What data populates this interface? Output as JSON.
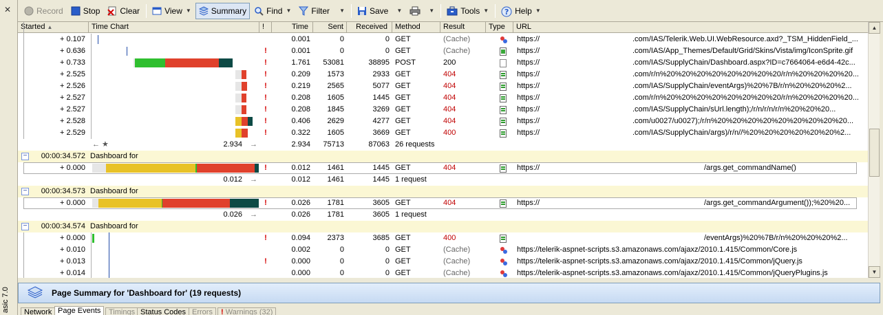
{
  "app": {
    "side_label": "asic 7.0"
  },
  "toolbar": {
    "record": "Record",
    "stop": "Stop",
    "clear": "Clear",
    "view": "View",
    "summary": "Summary",
    "find": "Find",
    "filter": "Filter",
    "save": "Save",
    "tools": "Tools",
    "help": "Help"
  },
  "columns": {
    "started": "Started",
    "time_chart": "Time Chart",
    "bang": "!",
    "time": "Time",
    "sent": "Sent",
    "received": "Received",
    "method": "Method",
    "result": "Result",
    "type": "Type",
    "url": "URL"
  },
  "group1": {
    "rows": [
      {
        "started": "+ 0.107",
        "bang": "",
        "time": "0.001",
        "sent": "0",
        "received": "0",
        "method": "GET",
        "result": "(Cache)",
        "type": "icon-js",
        "url_a": "https://",
        "url_b": ".com/IAS/Telerik.Web.UI.WebResource.axd?_TSM_HiddenField_..."
      },
      {
        "started": "+ 0.636",
        "bang": "!",
        "time": "0.001",
        "sent": "0",
        "received": "0",
        "method": "GET",
        "result": "(Cache)",
        "type": "icon-img",
        "url_a": "https://",
        "url_b": ".com/IAS/App_Themes/Default/Grid/Skins/Vista/img/IconSprite.gif"
      },
      {
        "started": "+ 0.733",
        "bang": "!",
        "time": "1.761",
        "sent": "53081",
        "received": "38895",
        "method": "POST",
        "result": "200",
        "type": "icon-page",
        "url_a": "https://",
        "url_b": ".com/IAS/SupplyChain/Dashboard.aspx?ID=c7664064-e6d4-42c..."
      },
      {
        "started": "+ 2.525",
        "bang": "!",
        "time": "0.209",
        "sent": "1573",
        "received": "2933",
        "method": "GET",
        "result": "404",
        "type": "icon-html",
        "url_a": "https://",
        "url_b": ".com/r/n%20%20%20%20%20%20%20%20/r/n%20%20%20%20..."
      },
      {
        "started": "+ 2.526",
        "bang": "!",
        "time": "0.219",
        "sent": "2565",
        "received": "5077",
        "method": "GET",
        "result": "404",
        "type": "icon-html",
        "url_a": "https://",
        "url_b": ".com/IAS/SupplyChain/eventArgs)%20%7B/r/n%20%20%20%2..."
      },
      {
        "started": "+ 2.527",
        "bang": "!",
        "time": "0.208",
        "sent": "1605",
        "received": "1445",
        "method": "GET",
        "result": "404",
        "type": "icon-html",
        "url_a": "https://",
        "url_b": ".com/r/n%20%20%20%20%20%20%20%20/r/n%20%20%20%20..."
      },
      {
        "started": "+ 2.527",
        "bang": "!",
        "time": "0.208",
        "sent": "1845",
        "received": "3269",
        "method": "GET",
        "result": "404",
        "type": "icon-html",
        "url_a": "https://",
        "url_b": ".com/IAS/SupplyChain/sUrl.length);/r/n/r/n/r/n%20%20%20..."
      },
      {
        "started": "+ 2.528",
        "bang": "!",
        "time": "0.406",
        "sent": "2629",
        "received": "4277",
        "method": "GET",
        "result": "404",
        "type": "icon-html",
        "url_a": "https://",
        "url_b": ".com/u0027/u0027);/r/n%20%20%20%20%20%20%20%20%20..."
      },
      {
        "started": "+ 2.529",
        "bang": "!",
        "time": "0.322",
        "sent": "1605",
        "received": "3669",
        "method": "GET",
        "result": "400",
        "type": "icon-html",
        "url_a": "https://",
        "url_b": ".com/IAS/SupplyChain/args)/r/n//%20%20%20%20%20%20%2..."
      }
    ],
    "total": {
      "chart_value": "2.934",
      "time": "2.934",
      "sent": "75713",
      "received": "87063",
      "summary": "26 requests"
    }
  },
  "groups": [
    {
      "time": "00:00:34.572",
      "title": "Dashboard for",
      "row": {
        "started": "+ 0.000",
        "bang": "!",
        "time": "0.012",
        "sent": "1461",
        "received": "1445",
        "method": "GET",
        "result": "404",
        "type": "icon-html",
        "url_a": "https://",
        "url_b": "/args.get_commandName()"
      },
      "total": {
        "chart_value": "0.012",
        "time": "0.012",
        "sent": "1461",
        "received": "1445",
        "summary": "1 request"
      }
    },
    {
      "time": "00:00:34.573",
      "title": "Dashboard for",
      "row": {
        "started": "+ 0.000",
        "bang": "!",
        "time": "0.026",
        "sent": "1781",
        "received": "3605",
        "method": "GET",
        "result": "404",
        "type": "icon-html",
        "url_a": "https://",
        "url_b": "/args.get_commandArgument());%20%20..."
      },
      "total": {
        "chart_value": "0.026",
        "time": "0.026",
        "sent": "1781",
        "received": "3605",
        "summary": "1 request"
      }
    }
  ],
  "group4": {
    "time": "00:00:34.574",
    "title": "Dashboard for",
    "rows": [
      {
        "started": "+ 0.000",
        "bang": "!",
        "time": "0.094",
        "sent": "2373",
        "received": "3685",
        "method": "GET",
        "result": "400",
        "type": "icon-html",
        "url": "https://",
        "url_tail": "/eventArgs)%20%7B/r/n%20%20%20%2..."
      },
      {
        "started": "+ 0.010",
        "bang": "",
        "time": "0.002",
        "sent": "0",
        "received": "0",
        "method": "GET",
        "result": "(Cache)",
        "type": "icon-js",
        "url": "https://telerik-aspnet-scripts.s3.amazonaws.com/ajaxz/2010.1.415/Common/Core.js",
        "url_tail": ""
      },
      {
        "started": "+ 0.013",
        "bang": "!",
        "time": "0.000",
        "sent": "0",
        "received": "0",
        "method": "GET",
        "result": "(Cache)",
        "type": "icon-js",
        "url": "https://telerik-aspnet-scripts.s3.amazonaws.com/ajaxz/2010.1.415/Common/jQuery.js",
        "url_tail": ""
      },
      {
        "started": "+ 0.014",
        "bang": "",
        "time": "0.000",
        "sent": "0",
        "received": "0",
        "method": "GET",
        "result": "(Cache)",
        "type": "icon-js",
        "url": "https://telerik-aspnet-scripts.s3.amazonaws.com/ajaxz/2010.1.415/Common/jQueryPlugins.js",
        "url_tail": ""
      }
    ]
  },
  "summary_bar": {
    "text": "Page Summary for 'Dashboard for' (19 requests)"
  },
  "tabs": [
    "Network",
    "Page Events",
    "Timings",
    "Status Codes",
    "Errors",
    "Warnings (32)"
  ],
  "colors": {
    "blocked": "#e6e6e6",
    "connect": "#e8c227",
    "send": "#2fbf2f",
    "wait": "#e0412c",
    "receive": "#0d4a45",
    "error": "#c00000"
  }
}
